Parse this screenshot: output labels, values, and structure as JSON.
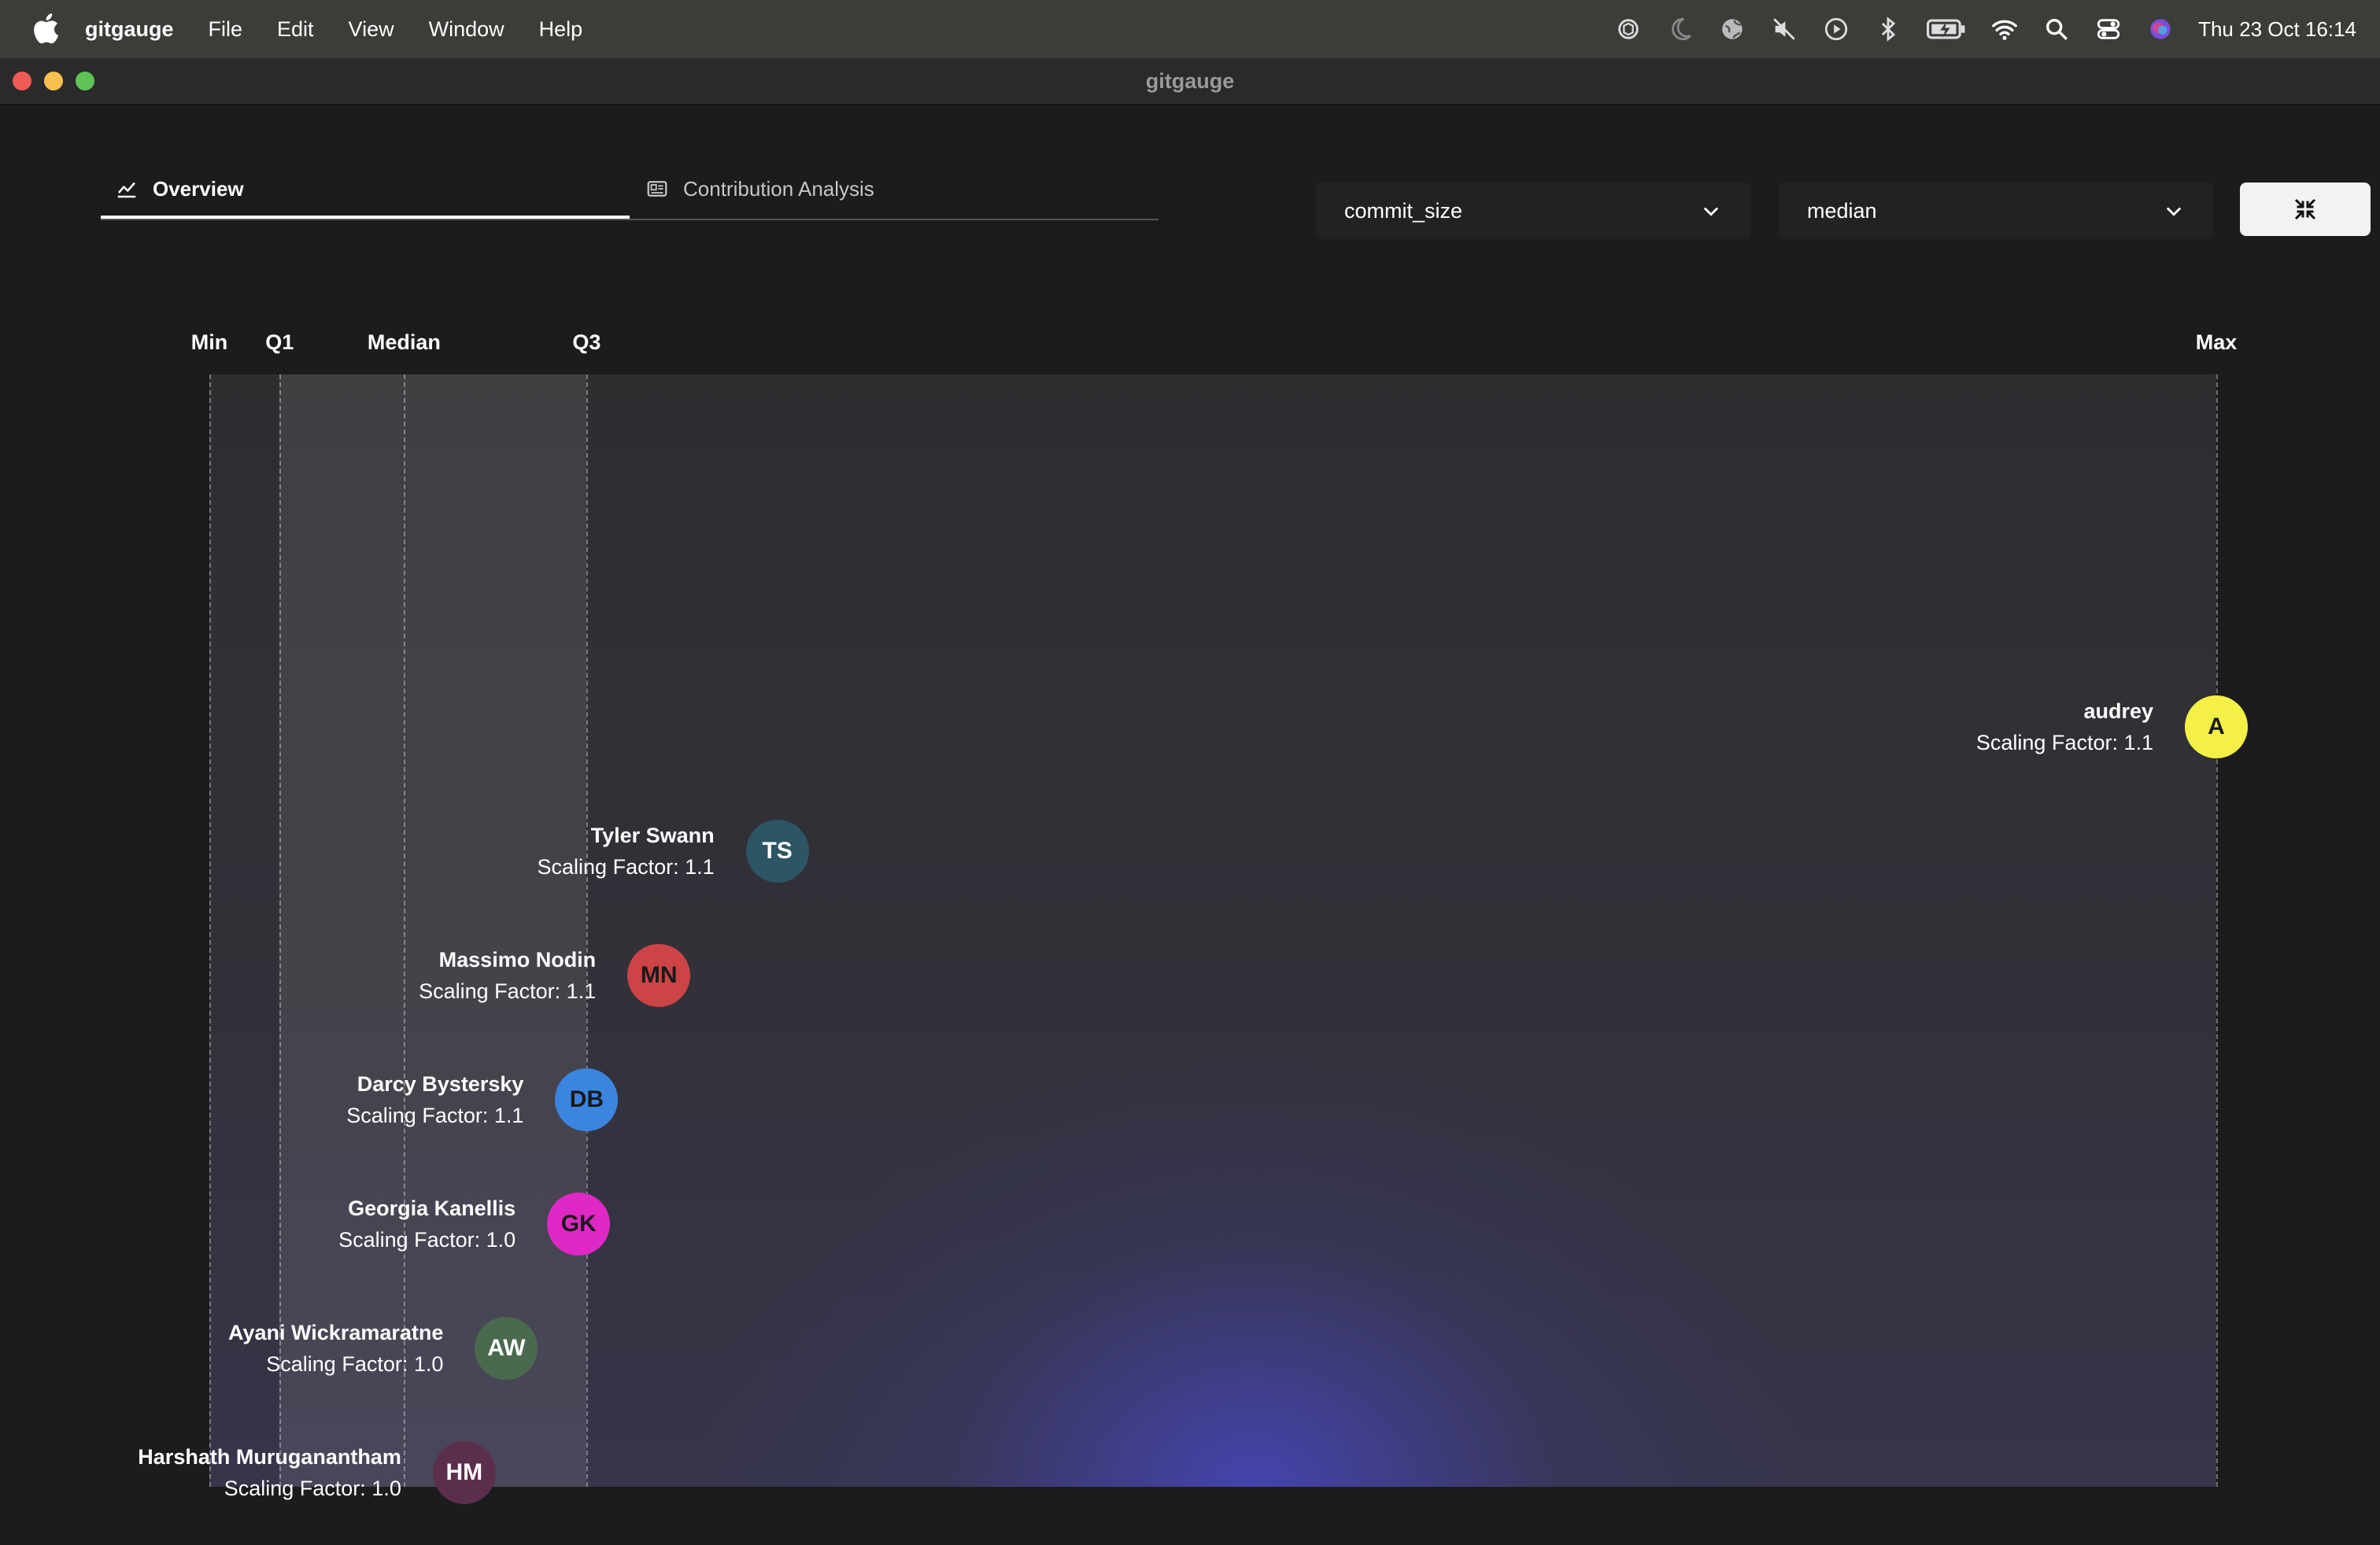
{
  "menubar": {
    "app_name": "gitgauge",
    "items": [
      "File",
      "Edit",
      "View",
      "Window",
      "Help"
    ],
    "clock": "Thu 23 Oct  16:14"
  },
  "window": {
    "title": "gitgauge"
  },
  "tabs": [
    {
      "label": "Overview",
      "icon": "chart-line-icon",
      "active": true
    },
    {
      "label": "Contribution Analysis",
      "icon": "id-card-icon",
      "active": false
    }
  ],
  "controls": {
    "metric_select": "commit_size",
    "statistic_select": "median"
  },
  "chart_data": {
    "type": "scatter",
    "axis_labels": [
      "Min",
      "Q1",
      "Median",
      "Q3",
      "Max"
    ],
    "stat_positions": {
      "Min": 0.0,
      "Q1": 0.035,
      "Median": 0.097,
      "Q3": 0.188,
      "Max": 1.0
    },
    "contributors": [
      {
        "name": "audrey",
        "initials": "A",
        "scaling_label": "Scaling Factor: 1.1",
        "position": 1.0,
        "color": "#f4f046",
        "text_color": "#1a1a1a"
      },
      {
        "name": "Tyler Swann",
        "initials": "TS",
        "scaling_label": "Scaling Factor: 1.1",
        "position": 0.283,
        "color": "#2c5566",
        "text_color": "#ffffff"
      },
      {
        "name": "Massimo Nodin",
        "initials": "MN",
        "scaling_label": "Scaling Factor: 1.1",
        "position": 0.224,
        "color": "#cc4446",
        "text_color": "#1a1a1a"
      },
      {
        "name": "Darcy Bystersky",
        "initials": "DB",
        "scaling_label": "Scaling Factor: 1.1",
        "position": 0.188,
        "color": "#3b85e0",
        "text_color": "#1a1a1a"
      },
      {
        "name": "Georgia Kanellis",
        "initials": "GK",
        "scaling_label": "Scaling Factor: 1.0",
        "position": 0.184,
        "color": "#e028c7",
        "text_color": "#1a1a1a"
      },
      {
        "name": "Ayani Wickramaratne",
        "initials": "AW",
        "scaling_label": "Scaling Factor: 1.0",
        "position": 0.148,
        "color": "#4a6a4e",
        "text_color": "#ffffff"
      },
      {
        "name": "Harshath Muruganantham",
        "initials": "HM",
        "scaling_label": "Scaling Factor: 1.0",
        "position": 0.127,
        "color": "#5b2e4e",
        "text_color": "#ffffff"
      }
    ]
  }
}
